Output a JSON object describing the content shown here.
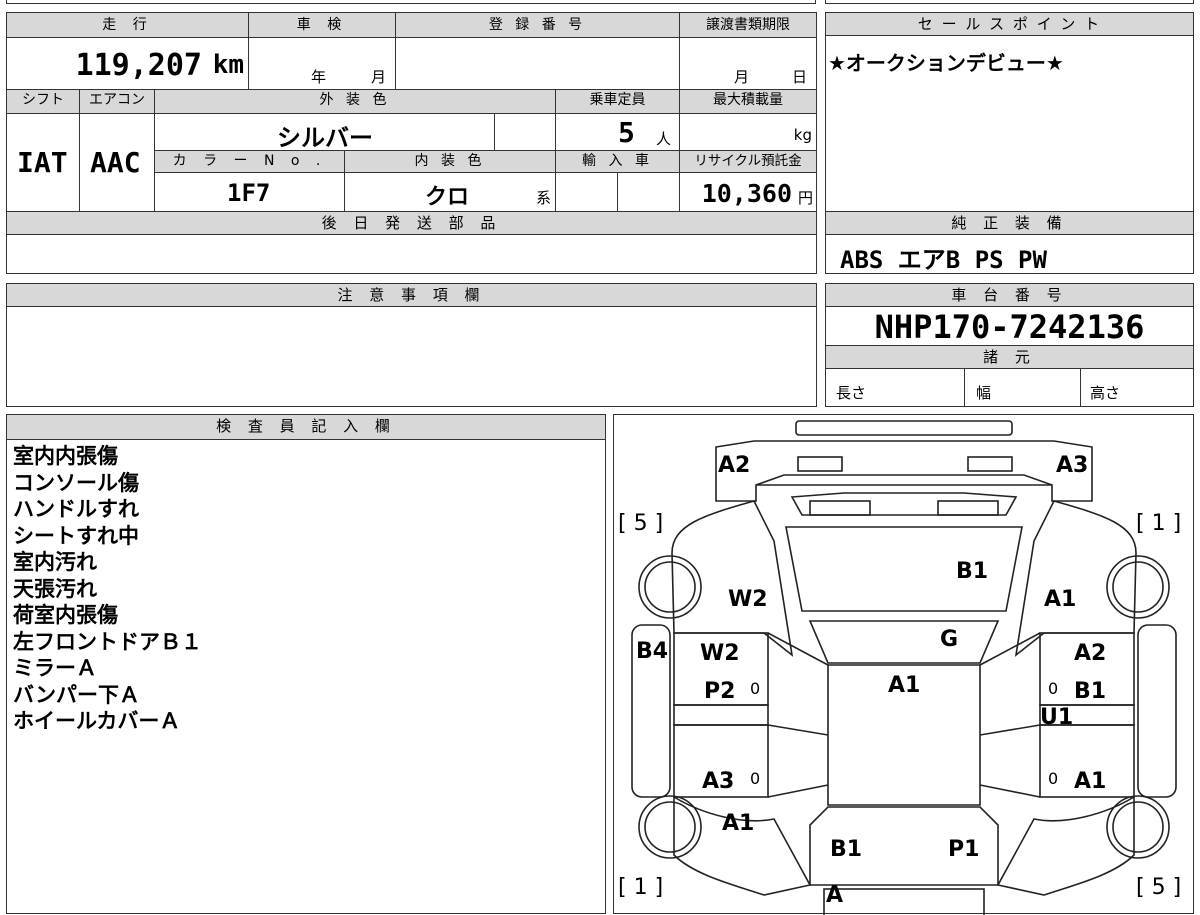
{
  "top_info": {
    "mileage_label": "走 行",
    "mileage_value": "119,207",
    "mileage_unit": "km",
    "inspection_label": "車 検",
    "inspection_year": "年",
    "inspection_month": "月",
    "registration_label": "登 録 番 号",
    "transfer_label": "譲渡書類期限",
    "transfer_month": "月",
    "transfer_day": "日"
  },
  "sales_point": {
    "label": "セ ー ル ス ポ イ ン ト",
    "text": "★オークションデビュー★"
  },
  "spec": {
    "shift_label": "シフト",
    "shift_value": "IAT",
    "ac_label": "エアコン",
    "ac_value": "AAC",
    "exterior_label": "外 装 色",
    "exterior_value": "シルバー",
    "capacity_label": "乗車定員",
    "capacity_value": "5",
    "capacity_unit": "人",
    "load_label": "最大積載量",
    "load_unit": "kg",
    "color_no_label": "カ ラ ー N o .",
    "color_no_value": "1F7",
    "interior_label": "内 装 色",
    "interior_value": "クロ",
    "interior_unit": "系",
    "import_label": "輸 入 車",
    "recycle_label": "リサイクル預託金",
    "recycle_value": "10,360",
    "recycle_unit": "円"
  },
  "later_parts": {
    "label": "後 日 発 送 部 品"
  },
  "genuine": {
    "label": "純 正 装 備",
    "value": "ABS エアB PS PW"
  },
  "notes": {
    "label": "注 意 事 項 欄"
  },
  "chassis": {
    "label": "車 台 番 号",
    "value": "NHP170-7242136",
    "specs_label": "諸 元",
    "length_label": "長さ",
    "width_label": "幅",
    "height_label": "高さ"
  },
  "inspector": {
    "label": "検 査 員 記 入 欄",
    "items": [
      "室内内張傷",
      "コンソール傷",
      "ハンドルすれ",
      "シートすれ中",
      "室内汚れ",
      "天張汚れ",
      "荷室内張傷",
      "左フロントドアＢ１",
      "ミラーＡ",
      "バンパー下Ａ",
      "ホイールカバーＡ"
    ]
  },
  "diagram": {
    "corner_tl": "[ 5 ]",
    "corner_tr": "[ 1 ]",
    "corner_bl": "[ 1 ]",
    "corner_br": "[ 5 ]",
    "labels": {
      "a2_top": "A2",
      "a3_top": "A3",
      "b1_hood": "B1",
      "w2_left": "W2",
      "a1_right": "A1",
      "g": "G",
      "b4": "B4",
      "w2_door": "W2",
      "a2_door": "A2",
      "a1_roof": "A1",
      "p2": "P2",
      "b1_door": "B1",
      "u1": "U1",
      "a3_door": "A3",
      "a1_door_r": "A1",
      "a1_rear_l": "A1",
      "b1_rear": "B1",
      "p1_rear": "P1",
      "a_bottom": "A",
      "zero": "0"
    }
  }
}
